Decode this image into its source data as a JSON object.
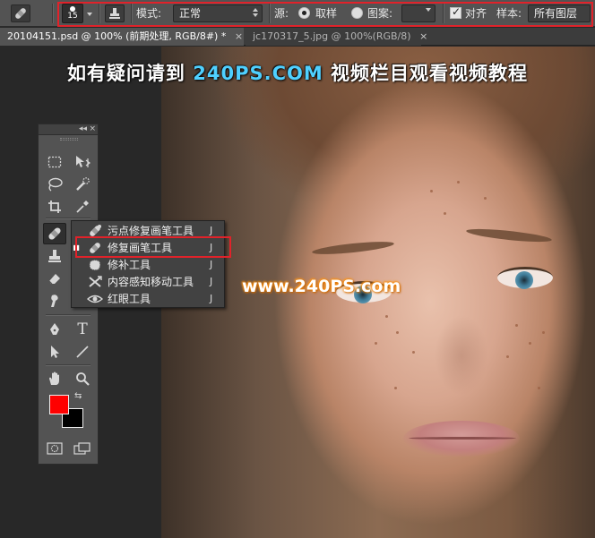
{
  "options_bar": {
    "brush_size": "15",
    "mode_label": "模式:",
    "mode_value": "正常",
    "source_label": "源:",
    "source_sampled": "取样",
    "source_pattern": "图案:",
    "aligned_label": "对齐",
    "aligned_checked": true,
    "sample_label": "样本:",
    "sample_value": "所有图层"
  },
  "tabs": [
    {
      "label": "20104151.psd @ 100% (前期处理, RGB/8#) *",
      "close": "×",
      "active": true
    },
    {
      "label": "jc170317_5.jpg @ 100%(RGB/8)",
      "close": "×",
      "active": false
    }
  ],
  "canvas": {
    "banner_prefix": "如有疑问请到 ",
    "banner_brand": "240PS.COM",
    "banner_suffix": " 视频栏目观看视频教程",
    "watermark": "www.240PS.com"
  },
  "tools_panel": {
    "collapse": "◂◂",
    "close": "×",
    "tools": [
      {
        "name": "marquee-tool",
        "icon": "marquee-icon"
      },
      {
        "name": "move-tool",
        "icon": "move-icon"
      },
      {
        "name": "lasso-tool",
        "icon": "lasso-icon"
      },
      {
        "name": "quick-selection-tool",
        "icon": "quick-selection-icon"
      },
      {
        "name": "crop-tool",
        "icon": "crop-icon"
      },
      {
        "name": "eyedropper-tool",
        "icon": "eyedropper-icon"
      },
      {
        "name": "healing-brush-tool",
        "icon": "bandage-icon",
        "selected": true
      },
      {
        "name": "brush-tool",
        "icon": "brush-icon"
      },
      {
        "name": "clone-stamp-tool",
        "icon": "stamp-icon"
      },
      {
        "name": "history-brush-tool",
        "icon": "history-brush-icon"
      },
      {
        "name": "eraser-tool",
        "icon": "eraser-icon"
      },
      {
        "name": "gradient-tool",
        "icon": "gradient-icon"
      },
      {
        "name": "smudge-tool",
        "icon": "smudge-icon"
      },
      {
        "name": "dodge-tool",
        "icon": "dodge-icon"
      },
      {
        "name": "pen-tool",
        "icon": "pen-icon"
      },
      {
        "name": "type-tool",
        "icon": "type-icon",
        "label": "T"
      },
      {
        "name": "path-selection-tool",
        "icon": "arrow-icon"
      },
      {
        "name": "line-tool",
        "icon": "line-icon"
      },
      {
        "name": "hand-tool",
        "icon": "hand-icon"
      },
      {
        "name": "zoom-tool",
        "icon": "magnifier-icon"
      }
    ],
    "foreground_color": "#ff0000",
    "background_color": "#000000"
  },
  "flyout": {
    "items": [
      {
        "label": "污点修复画笔工具",
        "shortcut": "J",
        "icon": "spot-healing-icon",
        "current": false
      },
      {
        "label": "修复画笔工具",
        "shortcut": "J",
        "icon": "healing-brush-icon",
        "current": true
      },
      {
        "label": "修补工具",
        "shortcut": "J",
        "icon": "patch-icon",
        "current": false
      },
      {
        "label": "内容感知移动工具",
        "shortcut": "J",
        "icon": "content-aware-move-icon",
        "current": false
      },
      {
        "label": "红眼工具",
        "shortcut": "J",
        "icon": "red-eye-icon",
        "current": false
      }
    ]
  },
  "colors": {
    "highlight_frame": "#e1222a",
    "brand_blue": "#4fd0ff",
    "watermark_glow": "#ff8a00"
  }
}
